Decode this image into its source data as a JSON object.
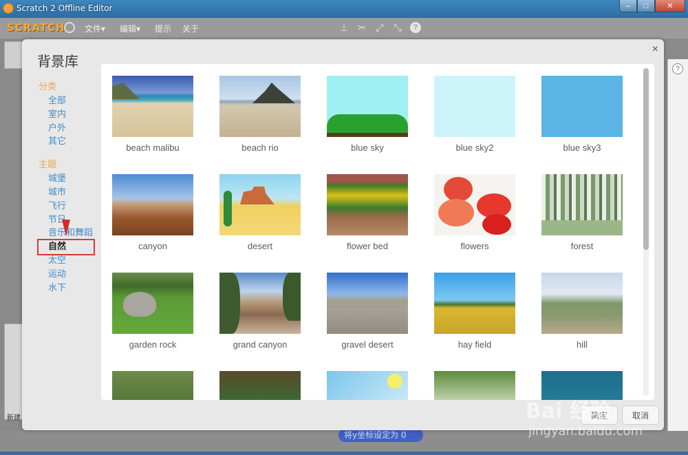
{
  "window": {
    "title": "Scratch 2 Offline Editor",
    "min": "–",
    "max": "□",
    "close": "✕"
  },
  "menubar": {
    "logo": "SCRATCH",
    "items": [
      "文件▾",
      "编辑▾",
      "提示",
      "关于"
    ]
  },
  "modal": {
    "title": "背景库",
    "close": "×",
    "ok_label": "确定",
    "cancel_label": "取消"
  },
  "sidebar": {
    "category_heading": "分类",
    "categories": [
      "全部",
      "室内",
      "户外",
      "其它"
    ],
    "theme_heading": "主题",
    "themes": [
      "城堡",
      "城市",
      "飞行",
      "节日",
      "音乐和舞蹈",
      "自然",
      "太空",
      "运动",
      "水下"
    ],
    "selected": "自然"
  },
  "backdrops": [
    {
      "name": "beach malibu"
    },
    {
      "name": "beach rio"
    },
    {
      "name": "blue sky"
    },
    {
      "name": "blue sky2"
    },
    {
      "name": "blue sky3"
    },
    {
      "name": "canyon"
    },
    {
      "name": "desert"
    },
    {
      "name": "flower bed"
    },
    {
      "name": "flowers"
    },
    {
      "name": "forest"
    },
    {
      "name": "garden rock"
    },
    {
      "name": "grand canyon"
    },
    {
      "name": "gravel desert"
    },
    {
      "name": "hay field"
    },
    {
      "name": "hill"
    }
  ],
  "background_block": "将y坐标设定为 0",
  "background_new": "新建",
  "watermark": {
    "main": "Bai 经验",
    "sub": "jingyan.baidu.com"
  }
}
